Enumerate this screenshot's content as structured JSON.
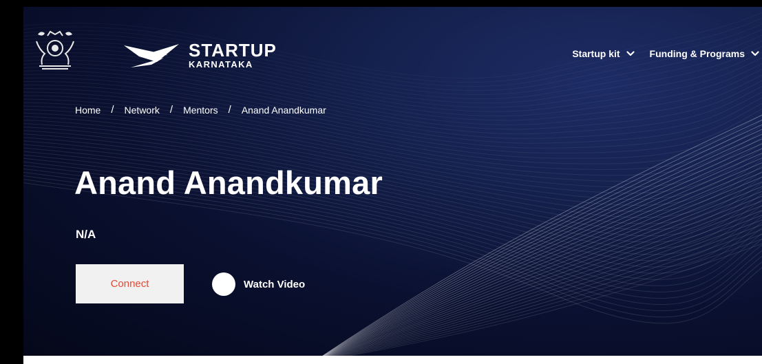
{
  "header": {
    "emblem_icon": "karnataka-emblem-icon",
    "logo": {
      "line1": "STARTUP",
      "line2": "KARNATAKA",
      "mark_icon": "startup-karnataka-logo-icon"
    },
    "nav": [
      {
        "label": "Startup kit",
        "icon": "chevron-down-icon"
      },
      {
        "label": "Funding & Programs",
        "icon": "chevron-down-icon"
      }
    ]
  },
  "breadcrumb": {
    "items": [
      "Home",
      "Network",
      "Mentors",
      "Anand Anandkumar"
    ],
    "separator": "/"
  },
  "profile": {
    "name": "Anand Anandkumar",
    "subtitle": "N/A"
  },
  "actions": {
    "connect_label": "Connect",
    "watch_label": "Watch Video",
    "watch_icon": "play-circle-icon"
  },
  "colors": {
    "hero_background": "#0d1538",
    "connect_text": "#e24a34",
    "connect_background": "#f1f1f1",
    "text": "#ffffff"
  }
}
